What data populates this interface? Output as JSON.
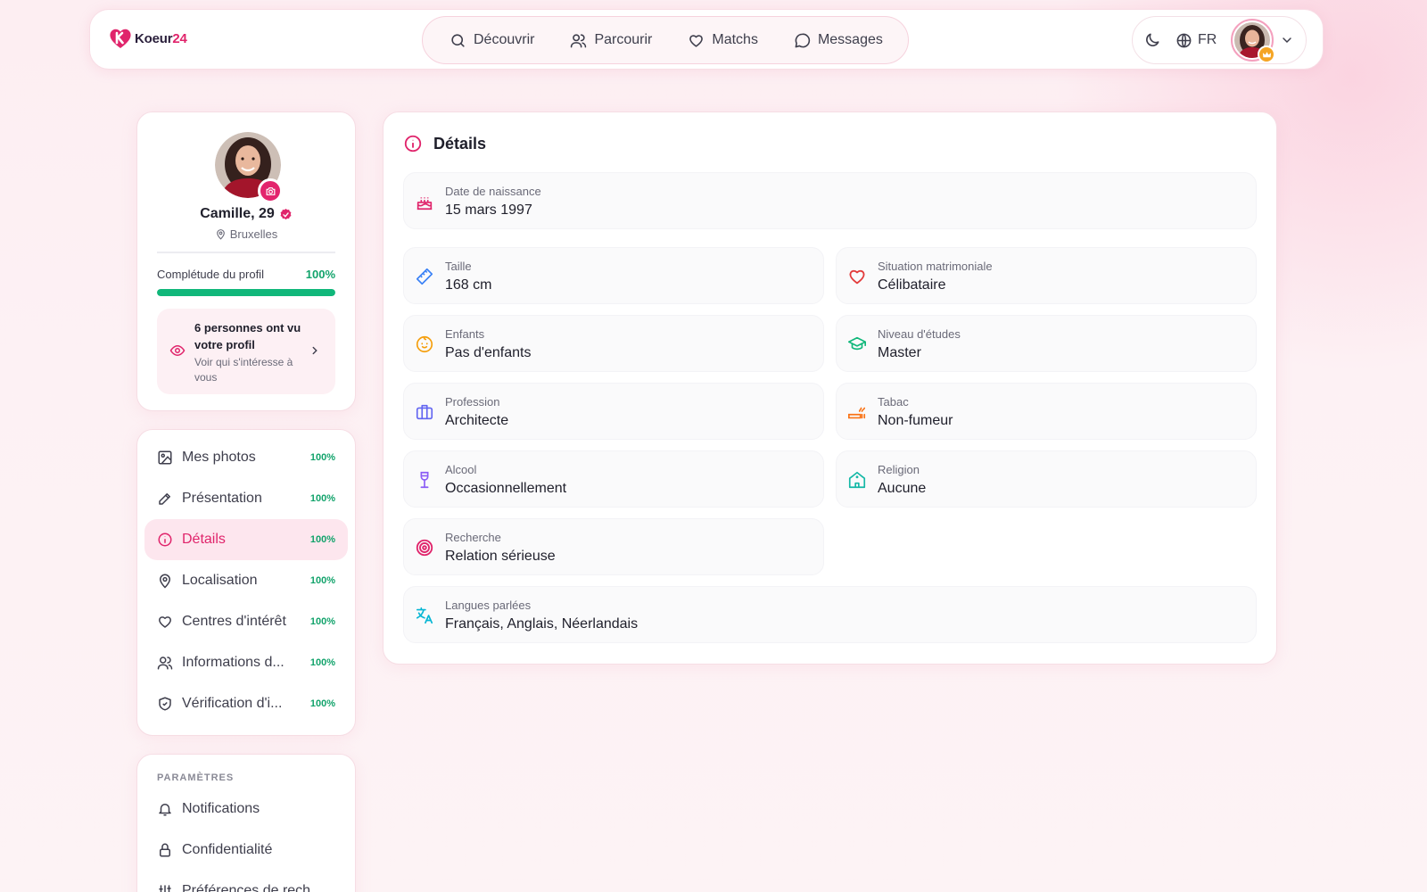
{
  "header": {
    "logo_text": "Koeur",
    "logo_num": "24",
    "nav": [
      {
        "label": "Découvrir",
        "icon": "search-icon"
      },
      {
        "label": "Parcourir",
        "icon": "users-icon"
      },
      {
        "label": "Matchs",
        "icon": "heart-icon"
      },
      {
        "label": "Messages",
        "icon": "chat-icon"
      }
    ],
    "lang": "FR"
  },
  "profile": {
    "name": "Camille, 29",
    "city": "Bruxelles",
    "completion_label": "Complétude du profil",
    "completion_pct": "100%",
    "completion_value": 100,
    "views_title": "6 personnes ont vu votre profil",
    "views_sub": "Voir qui s'intéresse à vous"
  },
  "menu": [
    {
      "label": "Mes photos",
      "pct": "100%",
      "icon": "image-icon"
    },
    {
      "label": "Présentation",
      "pct": "100%",
      "icon": "pen-icon"
    },
    {
      "label": "Détails",
      "pct": "100%",
      "icon": "info-icon",
      "active": true
    },
    {
      "label": "Localisation",
      "pct": "100%",
      "icon": "pin-icon"
    },
    {
      "label": "Centres d'intérêt",
      "pct": "100%",
      "icon": "heart-icon"
    },
    {
      "label": "Informations d...",
      "pct": "100%",
      "icon": "users-icon"
    },
    {
      "label": "Vérification d'i...",
      "pct": "100%",
      "icon": "shield-icon"
    }
  ],
  "settings": {
    "title": "PARAMÈTRES",
    "items": [
      {
        "label": "Notifications",
        "icon": "bell-icon"
      },
      {
        "label": "Confidentialité",
        "icon": "lock-icon"
      },
      {
        "label": "Préférences de rech",
        "icon": "sliders-icon"
      }
    ]
  },
  "details": {
    "title": "Détails",
    "birth": {
      "label": "Date de naissance",
      "value": "15 mars 1997"
    },
    "height": {
      "label": "Taille",
      "value": "168 cm"
    },
    "marital": {
      "label": "Situation matrimoniale",
      "value": "Célibataire"
    },
    "children": {
      "label": "Enfants",
      "value": "Pas d'enfants"
    },
    "education": {
      "label": "Niveau d'études",
      "value": "Master"
    },
    "profession": {
      "label": "Profession",
      "value": "Architecte"
    },
    "smoking": {
      "label": "Tabac",
      "value": "Non-fumeur"
    },
    "alcohol": {
      "label": "Alcool",
      "value": "Occasionnellement"
    },
    "religion": {
      "label": "Religion",
      "value": "Aucune"
    },
    "seeking": {
      "label": "Recherche",
      "value": "Relation sérieuse"
    },
    "languages": {
      "label": "Langues parlées",
      "value": "Français, Anglais, Néerlandais"
    }
  },
  "colors": {
    "brand": "#e0246b",
    "success": "#10b77a",
    "background": "#fdeef2"
  }
}
